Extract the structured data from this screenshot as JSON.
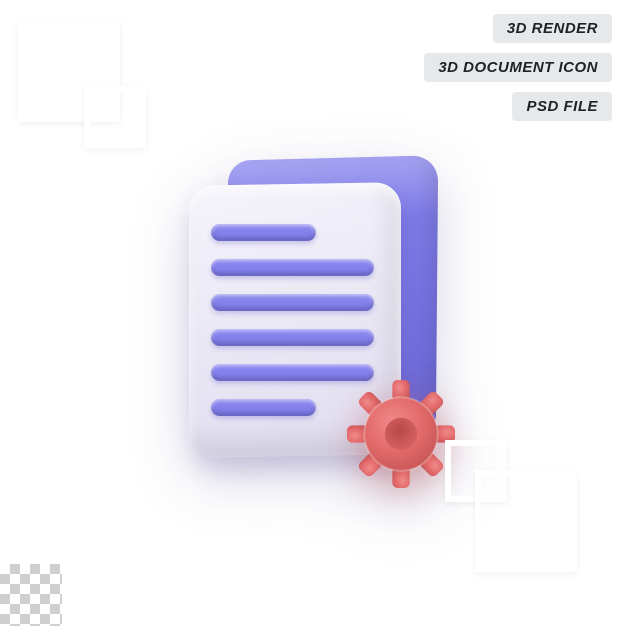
{
  "tags": {
    "items": [
      {
        "label": "3D RENDER"
      },
      {
        "label": "3D DOCUMENT ICON"
      },
      {
        "label": "PSD FILE"
      }
    ]
  },
  "icon": {
    "name": "document-settings-3d-icon"
  }
}
